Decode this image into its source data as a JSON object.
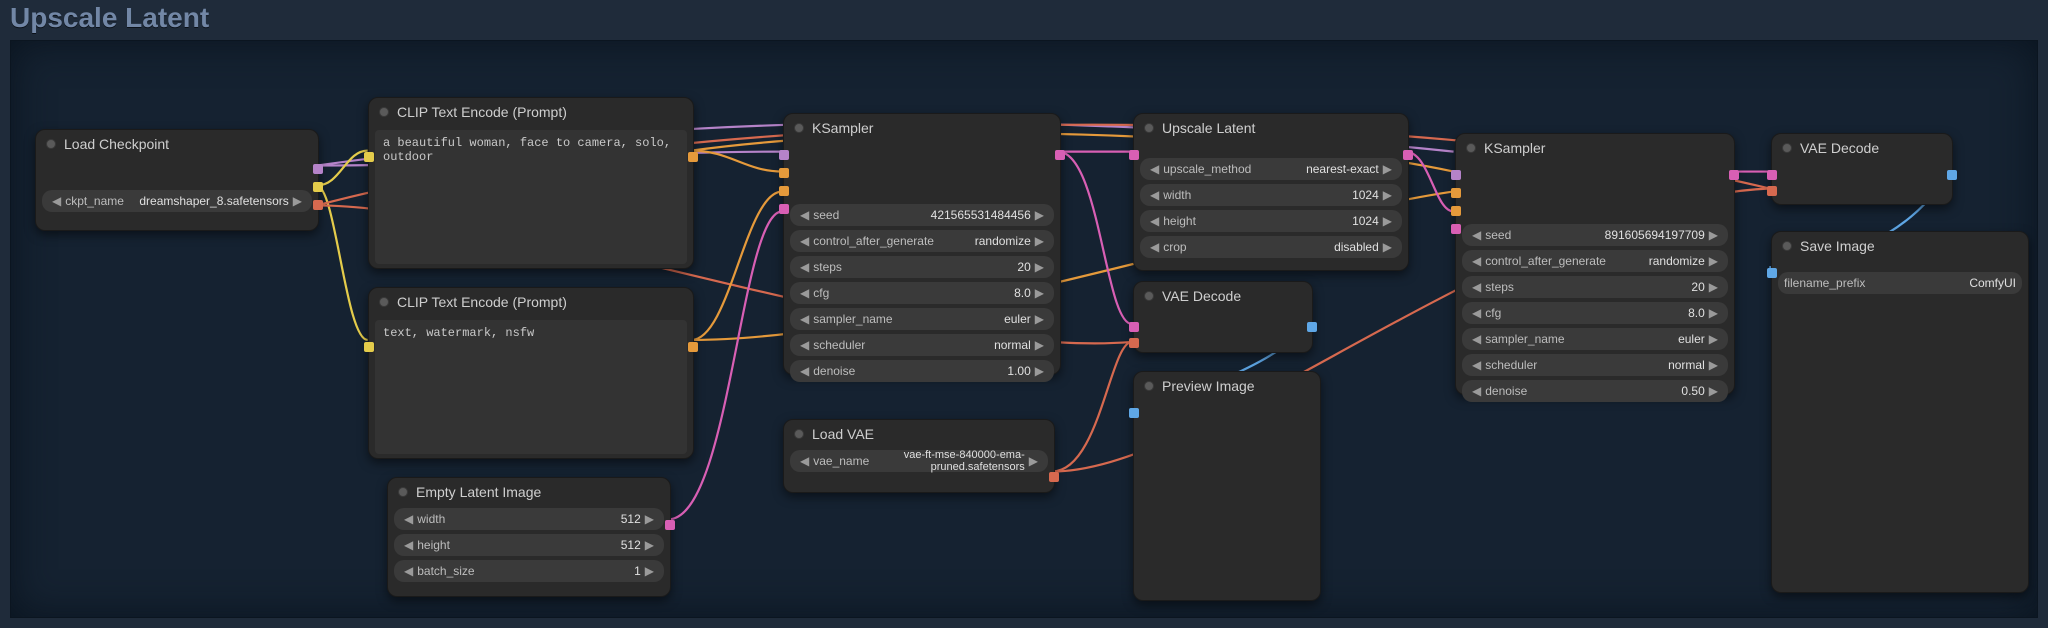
{
  "panel": {
    "title": "Upscale Latent"
  },
  "nodes": {
    "load_checkpoint": {
      "title": "Load Checkpoint",
      "widget": {
        "label": "ckpt_name",
        "value": "dreamshaper_8.safetensors"
      }
    },
    "clip_pos": {
      "title": "CLIP Text Encode (Prompt)",
      "text": "a beautiful woman, face to camera, solo, outdoor"
    },
    "clip_neg": {
      "title": "CLIP Text Encode (Prompt)",
      "text": "text, watermark, nsfw"
    },
    "empty_latent": {
      "title": "Empty Latent Image",
      "params": [
        {
          "label": "width",
          "value": "512"
        },
        {
          "label": "height",
          "value": "512"
        },
        {
          "label": "batch_size",
          "value": "1"
        }
      ]
    },
    "ksampler1": {
      "title": "KSampler",
      "params": [
        {
          "label": "seed",
          "value": "421565531484456"
        },
        {
          "label": "control_after_generate",
          "value": "randomize"
        },
        {
          "label": "steps",
          "value": "20"
        },
        {
          "label": "cfg",
          "value": "8.0"
        },
        {
          "label": "sampler_name",
          "value": "euler"
        },
        {
          "label": "scheduler",
          "value": "normal"
        },
        {
          "label": "denoise",
          "value": "1.00"
        }
      ]
    },
    "load_vae": {
      "title": "Load VAE",
      "widget": {
        "label": "vae_name",
        "value": "vae-ft-mse-840000-ema-pruned.safetensors"
      }
    },
    "upscale_latent": {
      "title": "Upscale Latent",
      "params": [
        {
          "label": "upscale_method",
          "value": "nearest-exact"
        },
        {
          "label": "width",
          "value": "1024"
        },
        {
          "label": "height",
          "value": "1024"
        },
        {
          "label": "crop",
          "value": "disabled"
        }
      ]
    },
    "vae_decode1": {
      "title": "VAE Decode"
    },
    "preview_image": {
      "title": "Preview Image"
    },
    "ksampler2": {
      "title": "KSampler",
      "params": [
        {
          "label": "seed",
          "value": "891605694197709"
        },
        {
          "label": "control_after_generate",
          "value": "randomize"
        },
        {
          "label": "steps",
          "value": "20"
        },
        {
          "label": "cfg",
          "value": "8.0"
        },
        {
          "label": "sampler_name",
          "value": "euler"
        },
        {
          "label": "scheduler",
          "value": "normal"
        },
        {
          "label": "denoise",
          "value": "0.50"
        }
      ]
    },
    "vae_decode2": {
      "title": "VAE Decode"
    },
    "save_image": {
      "title": "Save Image",
      "widget": {
        "label": "filename_prefix",
        "value": "ComfyUI"
      }
    }
  },
  "ports": {
    "labeldot_desc": "small colored square on node edge; color = data type"
  },
  "colors": {
    "model": "#b583c9",
    "clip": "#e4cc4b",
    "vae": "#d6694f",
    "conditioning": "#e59a3b",
    "latent": "#d85fb4",
    "image": "#5fa7e6"
  }
}
